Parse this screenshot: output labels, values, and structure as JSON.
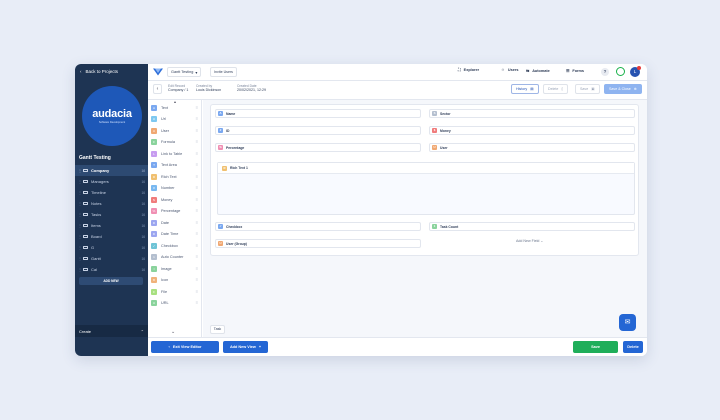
{
  "sidebar": {
    "back_label": "Back to Projects",
    "logo_text": "audacia",
    "logo_tagline": "Software Development",
    "project_name": "Gantt Testing",
    "items": [
      {
        "label": "Company",
        "count": "16"
      },
      {
        "label": "Managers",
        "count": "16"
      },
      {
        "label": "Timeline",
        "count": "16"
      },
      {
        "label": "Notes",
        "count": "16"
      },
      {
        "label": "Tasks",
        "count": "16"
      },
      {
        "label": "Items",
        "count": "16"
      },
      {
        "label": "Board",
        "count": "16"
      },
      {
        "label": "G",
        "count": "16"
      },
      {
        "label": "Gantt",
        "count": "16"
      },
      {
        "label": "Cal",
        "count": "16"
      }
    ],
    "add_new_label": "ADD NEW",
    "create_label": "Create"
  },
  "topbar": {
    "project_select": "Gantt Testing",
    "invite_label": "Invite Users",
    "tabs": {
      "explorer": "Explorer",
      "users": "Users",
      "automate": "Automate",
      "forms": "Forms"
    },
    "help": "?",
    "avatar_initial": "L"
  },
  "record_header": {
    "edit_record_label": "Edit Record",
    "edit_record_value": "Company / 1",
    "created_by_label": "Created by",
    "created_by_value": "Louis Dickinson",
    "created_date_label": "Created Date",
    "created_date_value": "20/02/2021, 12:29",
    "history_label": "History",
    "delete_label": "Delete",
    "save_label": "Save",
    "save_close_label": "Save & Close"
  },
  "palette": [
    {
      "label": "Text",
      "color": "#7aa8f0",
      "glyph": "A"
    },
    {
      "label": "Url",
      "color": "#7ec8f0",
      "glyph": "U"
    },
    {
      "label": "User",
      "color": "#f0a872",
      "glyph": "U"
    },
    {
      "label": "Formula",
      "color": "#8ad39c",
      "glyph": "F"
    },
    {
      "label": "Link to Table",
      "color": "#c79cf0",
      "glyph": "L"
    },
    {
      "label": "Text Area",
      "color": "#7aa8f0",
      "glyph": "T"
    },
    {
      "label": "Rich Text",
      "color": "#f0c070",
      "glyph": "R"
    },
    {
      "label": "Number",
      "color": "#79b8f0",
      "glyph": "#"
    },
    {
      "label": "Money",
      "color": "#f07b7b",
      "glyph": "$"
    },
    {
      "label": "Percentage",
      "color": "#f08fb3",
      "glyph": "%"
    },
    {
      "label": "Date",
      "color": "#9ca6f0",
      "glyph": "D"
    },
    {
      "label": "Date Time",
      "color": "#9ca6f0",
      "glyph": "D"
    },
    {
      "label": "Checkbox",
      "color": "#6fc4d6",
      "glyph": "✓"
    },
    {
      "label": "Auto Counter",
      "color": "#b4bfcf",
      "glyph": "1"
    },
    {
      "label": "Image",
      "color": "#8ad39c",
      "glyph": "I"
    },
    {
      "label": "Icon",
      "color": "#f0b27a",
      "glyph": "★"
    },
    {
      "label": "File",
      "color": "#a8e080",
      "glyph": "F"
    },
    {
      "label": "URL",
      "color": "#8ad39c",
      "glyph": "U"
    }
  ],
  "form": {
    "fields": [
      {
        "label": "Name",
        "color": "#7aa8f0",
        "glyph": "A"
      },
      {
        "label": "Sector",
        "color": "#b4bfcf",
        "glyph": "S"
      },
      {
        "label": "ID",
        "color": "#7aa8f0",
        "glyph": "#"
      },
      {
        "label": "Money",
        "color": "#f07b7b",
        "glyph": "$"
      },
      {
        "label": "Percentage",
        "color": "#f08fb3",
        "glyph": "%"
      },
      {
        "label": "User",
        "color": "#f0a872",
        "glyph": "U"
      },
      {
        "label": "Checkbox",
        "color": "#7aa8f0",
        "glyph": "✓"
      },
      {
        "label": "Task Count",
        "color": "#8ad39c",
        "glyph": "1"
      },
      {
        "label": "User (Group)",
        "color": "#f0a872",
        "glyph": "U"
      }
    ],
    "rich_text_label": "Rich Text 1",
    "rich_text_color": "#f0c070",
    "add_field_label": "Add New Field",
    "tab_label": "Task"
  },
  "bottombar": {
    "exit_label": "Exit View Editor",
    "add_view_label": "Add New View",
    "save_label": "Save",
    "delete_label": "Delete"
  },
  "colors": {
    "accent": "#2466d4",
    "sidebar": "#1e3453",
    "save_green": "#1fae5a",
    "logo_blue": "#1e58b8"
  }
}
